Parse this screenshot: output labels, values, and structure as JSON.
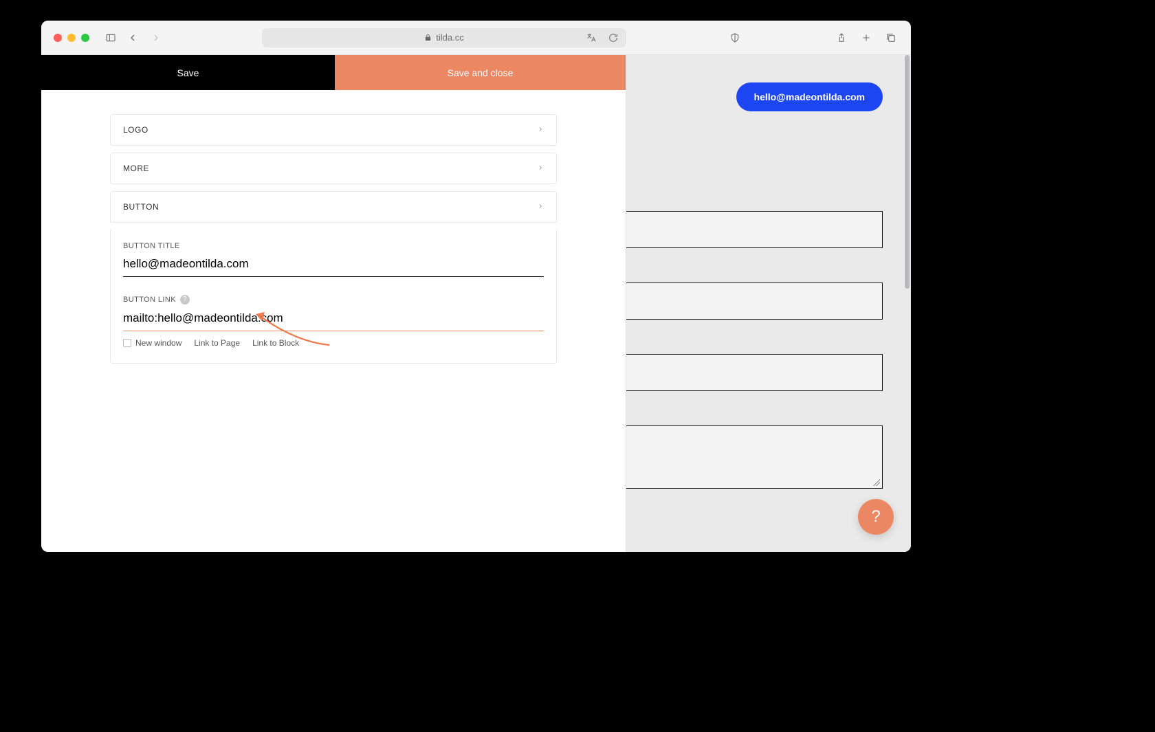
{
  "browser": {
    "url_domain": "tilda.cc"
  },
  "editor": {
    "save_label": "Save",
    "save_close_label": "Save and close",
    "sections": {
      "logo": {
        "label": "LOGO"
      },
      "more": {
        "label": "MORE"
      },
      "button": {
        "label": "BUTTON"
      }
    },
    "button_section": {
      "title_label": "BUTTON TITLE",
      "title_value": "hello@madeontilda.com",
      "link_label": "BUTTON LINK",
      "link_value": "mailto:hello@madeontilda.com",
      "under_links": {
        "new_window": "New window",
        "link_to_page": "Link to Page",
        "link_to_block": "Link to Block"
      }
    }
  },
  "preview": {
    "button_pill": "hello@madeontilda.com"
  },
  "help": {
    "symbol": "?"
  }
}
